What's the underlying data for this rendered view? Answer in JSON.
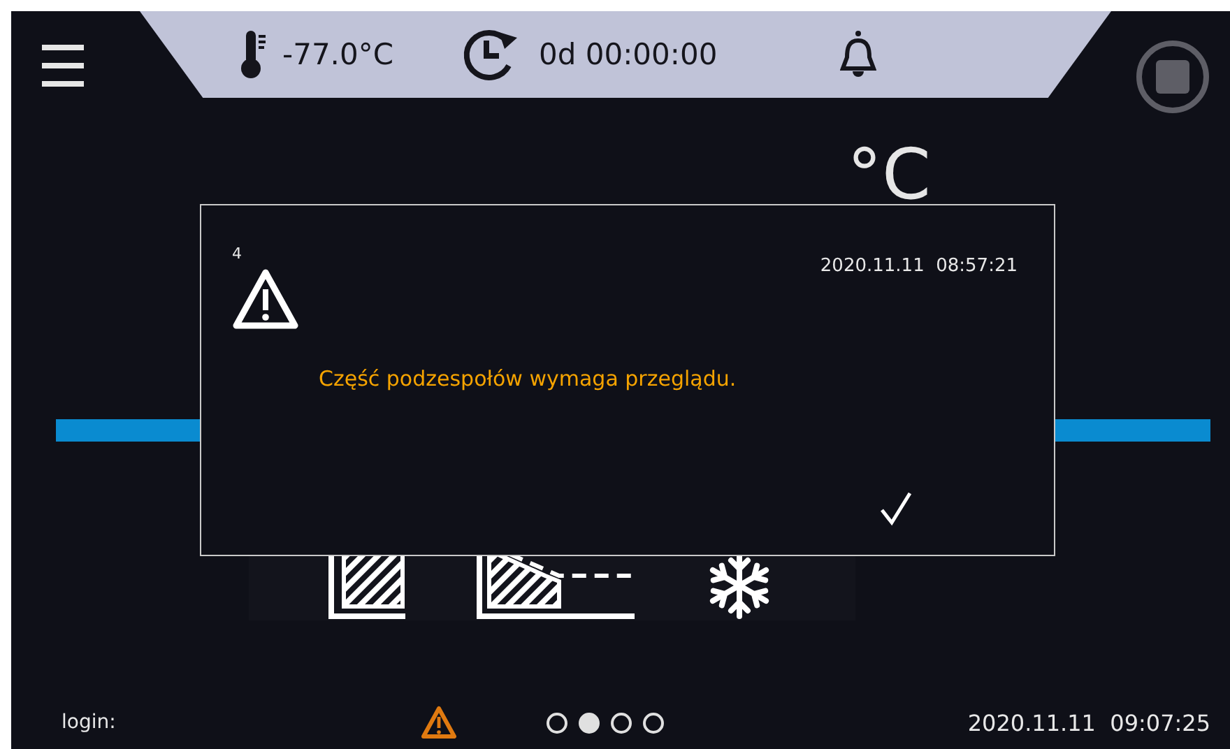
{
  "header": {
    "temperature": "-77.0°C",
    "timer": "0d 00:00:00"
  },
  "reading": {
    "unit": "°C"
  },
  "mode_icons": [
    {
      "kind": "chamber"
    },
    {
      "kind": "ramp"
    },
    {
      "kind": "cooling"
    }
  ],
  "dialog": {
    "number": "4",
    "timestamp": "2020.11.11  08:57:21",
    "message": "Część podzespołów wymaga przeglądu."
  },
  "status_bar": {
    "login_label": "login:",
    "alert": true,
    "pages": [
      {
        "selected": false
      },
      {
        "selected": true
      },
      {
        "selected": false
      },
      {
        "selected": false
      }
    ],
    "datetime": "2020.11.11  09:07:25"
  }
}
